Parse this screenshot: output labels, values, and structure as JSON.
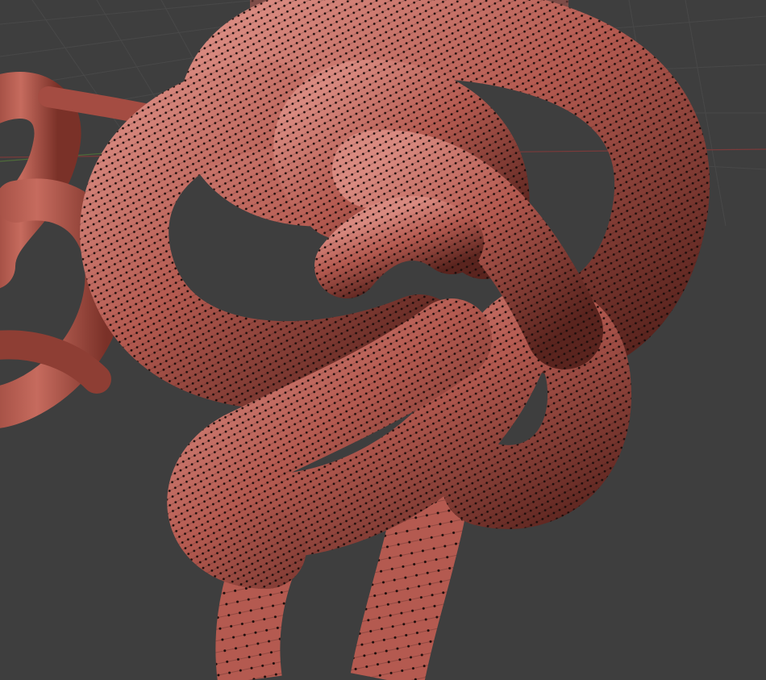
{
  "viewport": {
    "kind": "3d-sculpt-viewport",
    "background_color": "#3e3e3e",
    "grid_color": "#4a4a4a",
    "x_axis_color": "#7a3a3a",
    "y_axis_color": "#4e6b3a",
    "mesh_color": "#b45a50",
    "mesh_highlight_color": "#d98a80",
    "mesh_shadow_color": "#4a1e1a",
    "wireframe_color": "#1a0c0a",
    "objects": [
      {
        "name": "selected-knot-mesh",
        "display": "wireframe-overlay",
        "selected": true
      },
      {
        "name": "background-knot-mesh",
        "display": "solid",
        "selected": false
      },
      {
        "name": "hanging-rope-strands",
        "display": "sparse-wireframe",
        "selected": false
      }
    ]
  }
}
